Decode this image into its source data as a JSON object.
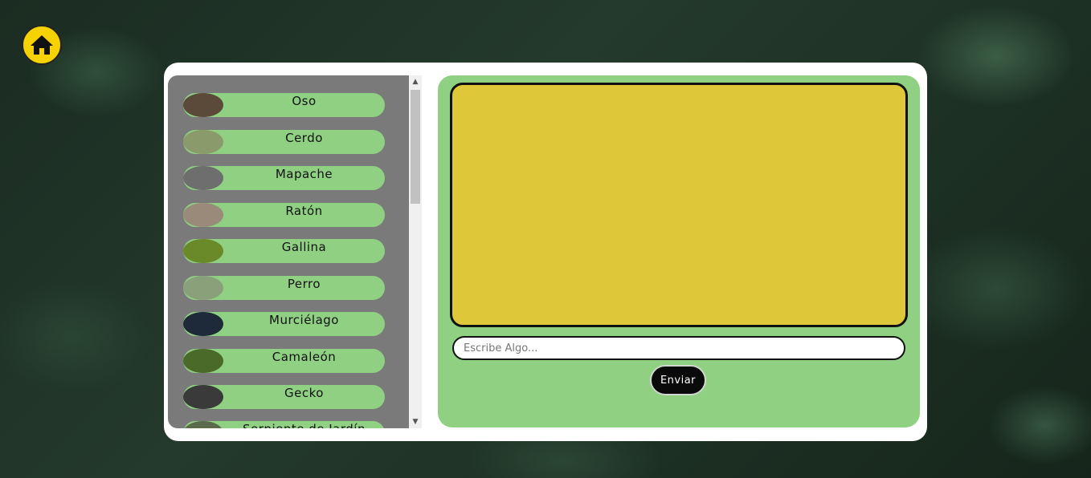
{
  "colors": {
    "home_button": "#f5d200",
    "panel_green": "#8fd082",
    "list_background": "#7a7a7a",
    "chat_box": "#dfc73a",
    "send_button": "#0a0a0a"
  },
  "home": {
    "icon": "home-icon"
  },
  "animals": [
    {
      "label": "Oso",
      "thumb_color": "#5b4a3a"
    },
    {
      "label": "Cerdo",
      "thumb_color": "#8a9a6a"
    },
    {
      "label": "Mapache",
      "thumb_color": "#6e6e6e"
    },
    {
      "label": "Ratón",
      "thumb_color": "#9a8a7a"
    },
    {
      "label": "Gallina",
      "thumb_color": "#6a8a2a"
    },
    {
      "label": "Perro",
      "thumb_color": "#8aa07a"
    },
    {
      "label": "Murciélago",
      "thumb_color": "#1e2a3a"
    },
    {
      "label": "Camaleón",
      "thumb_color": "#4a6a2a"
    },
    {
      "label": "Gecko",
      "thumb_color": "#3a3a3a"
    },
    {
      "label": "Serpiente de Jardín",
      "thumb_color": "#5a6a4a"
    }
  ],
  "chat": {
    "input_placeholder": "Escribe Algo...",
    "input_value": "",
    "send_label": "Enviar"
  }
}
